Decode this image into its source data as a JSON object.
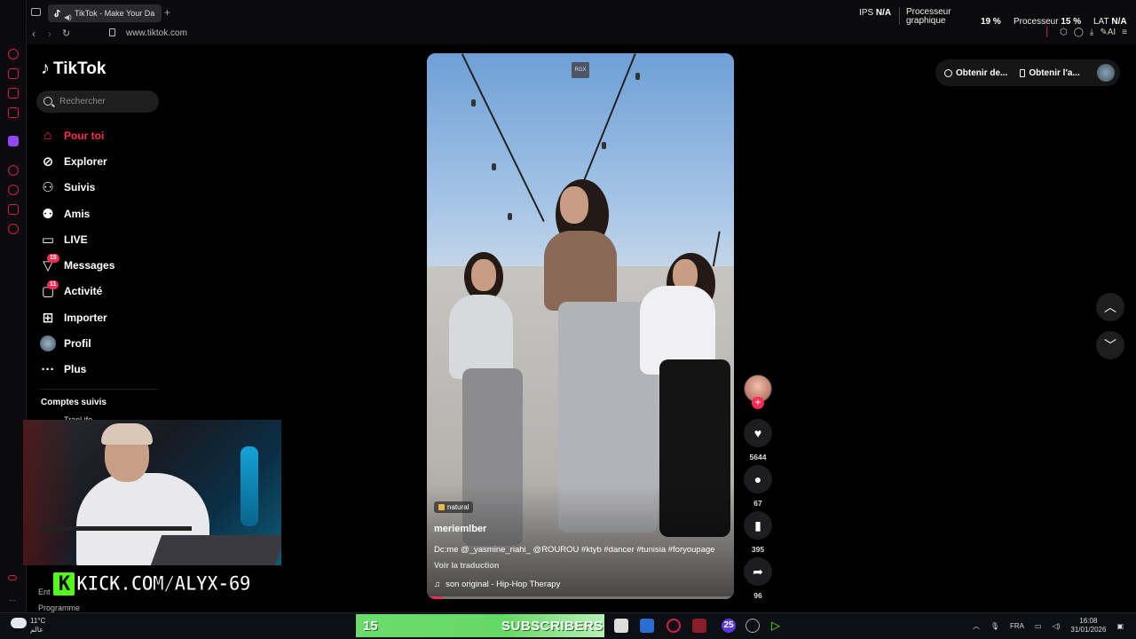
{
  "browser": {
    "tab_title": "TikTok - Make Your Da",
    "url": "www.tiktok.com"
  },
  "osd": {
    "ips_label": "IPS",
    "ips_value": "N/A",
    "gpu_label_1": "Processeur",
    "gpu_label_2": "graphique",
    "gpu_value": "19 %",
    "cpu_label": "Processeur",
    "cpu_value": "15 %",
    "lat_label": "LAT",
    "lat_value": "N/A"
  },
  "tiktok": {
    "logo": "TikTok",
    "search_placeholder": "Rechercher",
    "nav": [
      {
        "label": "Pour toi",
        "icon": "home-icon",
        "active": true
      },
      {
        "label": "Explorer",
        "icon": "compass-icon"
      },
      {
        "label": "Suivis",
        "icon": "user-follow-icon"
      },
      {
        "label": "Amis",
        "icon": "friends-icon"
      },
      {
        "label": "LIVE",
        "icon": "live-tv-icon"
      },
      {
        "label": "Messages",
        "icon": "messages-icon",
        "badge": "15"
      },
      {
        "label": "Activité",
        "icon": "activity-icon",
        "badge": "11"
      },
      {
        "label": "Importer",
        "icon": "upload-icon"
      },
      {
        "label": "Profil",
        "icon": "profile-avatar"
      },
      {
        "label": "Plus",
        "icon": "more-icon"
      }
    ],
    "following_title": "Comptes suivis",
    "following_first": "Tranl ife",
    "footer_ent": "Ent",
    "footer_prog": "Programme",
    "top_right": {
      "btn1": "Obtenir de...",
      "btn2": "Obtenir l'a..."
    }
  },
  "video": {
    "watermark": "RGX",
    "tag": "natural",
    "author": "meriemlber",
    "description": "Dc:me @_yasmine_riahi_ @ROUROU #ktyb #dancer #tunisia #foryoupage",
    "translate": "Voir la traduction",
    "music": "son original - Hip-Hop Therapy",
    "progress": 0.05,
    "likes": "5644",
    "comments": "67",
    "saves": "395",
    "shares": "96"
  },
  "overlay": {
    "kick_text": "KICK.COM/ALYX-69"
  },
  "taskbar": {
    "temp": "11°C",
    "weather_sub": "عالم",
    "subs_count": "15",
    "subs_label": "SUBSCRIBERS",
    "badge_25": "25",
    "lang": "FRA",
    "time": "16:08",
    "date": "31/01/2026"
  },
  "colors": {
    "accent": "#fe2c55",
    "kick_green": "#53fc18",
    "opera_red": "#d0224a"
  }
}
